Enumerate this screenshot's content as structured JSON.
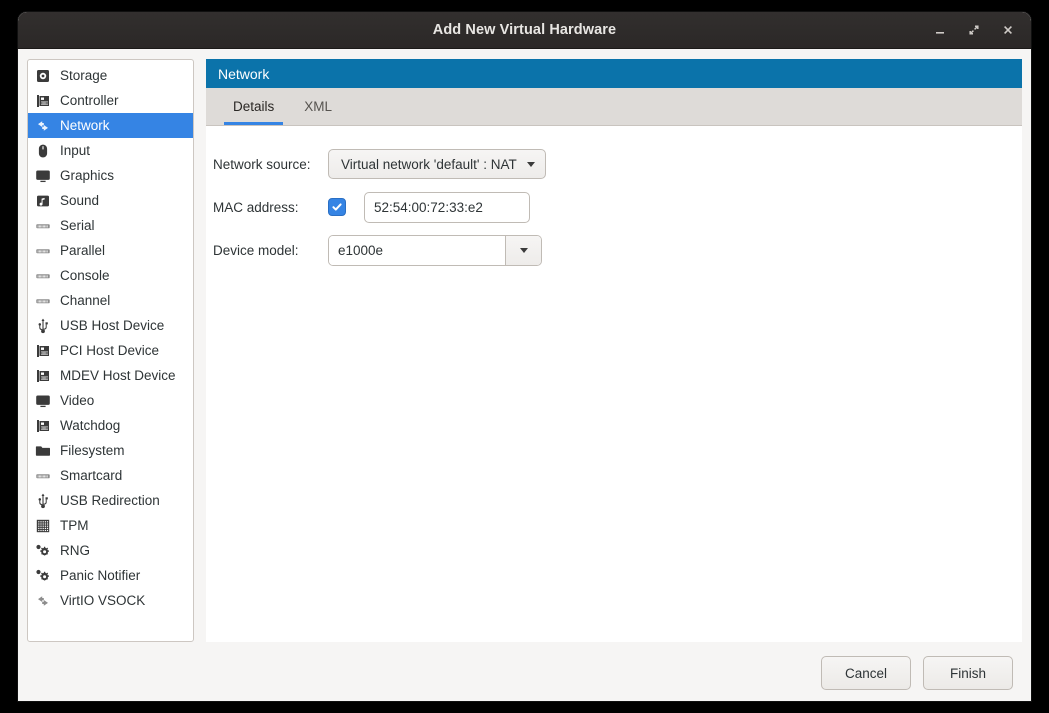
{
  "window": {
    "title": "Add New Virtual Hardware",
    "controls": [
      {
        "name": "minimize-button",
        "glyph": "minimize"
      },
      {
        "name": "maximize-button",
        "glyph": "maximize"
      },
      {
        "name": "close-button",
        "glyph": "close"
      }
    ]
  },
  "sidebar": {
    "items": [
      {
        "label": "Storage",
        "icon": "hard-disk-icon",
        "selected": false,
        "dim": false
      },
      {
        "label": "Controller",
        "icon": "pci-card-icon",
        "selected": false,
        "dim": false
      },
      {
        "label": "Network",
        "icon": "network-arrows-icon",
        "selected": true,
        "dim": false
      },
      {
        "label": "Input",
        "icon": "mouse-icon",
        "selected": false,
        "dim": false
      },
      {
        "label": "Graphics",
        "icon": "monitor-icon",
        "selected": false,
        "dim": false
      },
      {
        "label": "Sound",
        "icon": "sound-note-icon",
        "selected": false,
        "dim": false
      },
      {
        "label": "Serial",
        "icon": "serial-port-icon",
        "selected": false,
        "dim": true
      },
      {
        "label": "Parallel",
        "icon": "serial-port-icon",
        "selected": false,
        "dim": true
      },
      {
        "label": "Console",
        "icon": "serial-port-icon",
        "selected": false,
        "dim": true
      },
      {
        "label": "Channel",
        "icon": "serial-port-icon",
        "selected": false,
        "dim": true
      },
      {
        "label": "USB Host Device",
        "icon": "usb-icon",
        "selected": false,
        "dim": false
      },
      {
        "label": "PCI Host Device",
        "icon": "pci-card-icon",
        "selected": false,
        "dim": false
      },
      {
        "label": "MDEV Host Device",
        "icon": "pci-card-icon",
        "selected": false,
        "dim": false
      },
      {
        "label": "Video",
        "icon": "monitor-icon",
        "selected": false,
        "dim": false
      },
      {
        "label": "Watchdog",
        "icon": "pci-card-icon",
        "selected": false,
        "dim": false
      },
      {
        "label": "Filesystem",
        "icon": "folder-icon",
        "selected": false,
        "dim": false
      },
      {
        "label": "Smartcard",
        "icon": "serial-port-icon",
        "selected": false,
        "dim": true
      },
      {
        "label": "USB Redirection",
        "icon": "usb-icon",
        "selected": false,
        "dim": false
      },
      {
        "label": "TPM",
        "icon": "chip-grid-icon",
        "selected": false,
        "dim": false
      },
      {
        "label": "RNG",
        "icon": "gear-dot-icon",
        "selected": false,
        "dim": false
      },
      {
        "label": "Panic Notifier",
        "icon": "gear-dot-icon",
        "selected": false,
        "dim": false
      },
      {
        "label": "VirtIO VSOCK",
        "icon": "network-arrows-icon",
        "selected": false,
        "dim": true
      }
    ]
  },
  "content": {
    "banner_title": "Network",
    "tabs": [
      {
        "label": "Details",
        "active": true
      },
      {
        "label": "XML",
        "active": false
      }
    ],
    "form": {
      "network_source": {
        "label": "Network source:",
        "value": "Virtual network 'default' : NAT"
      },
      "mac_address": {
        "label": "MAC address:",
        "checked": true,
        "value": "52:54:00:72:33:e2"
      },
      "device_model": {
        "label": "Device model:",
        "value": "e1000e"
      }
    }
  },
  "footer": {
    "cancel_label": "Cancel",
    "finish_label": "Finish"
  },
  "colors": {
    "banner_blue": "#0b73aa",
    "selection_blue": "#3584e4",
    "dialog_bg": "#f6f5f4",
    "titlebar": "#2e2b2a"
  }
}
